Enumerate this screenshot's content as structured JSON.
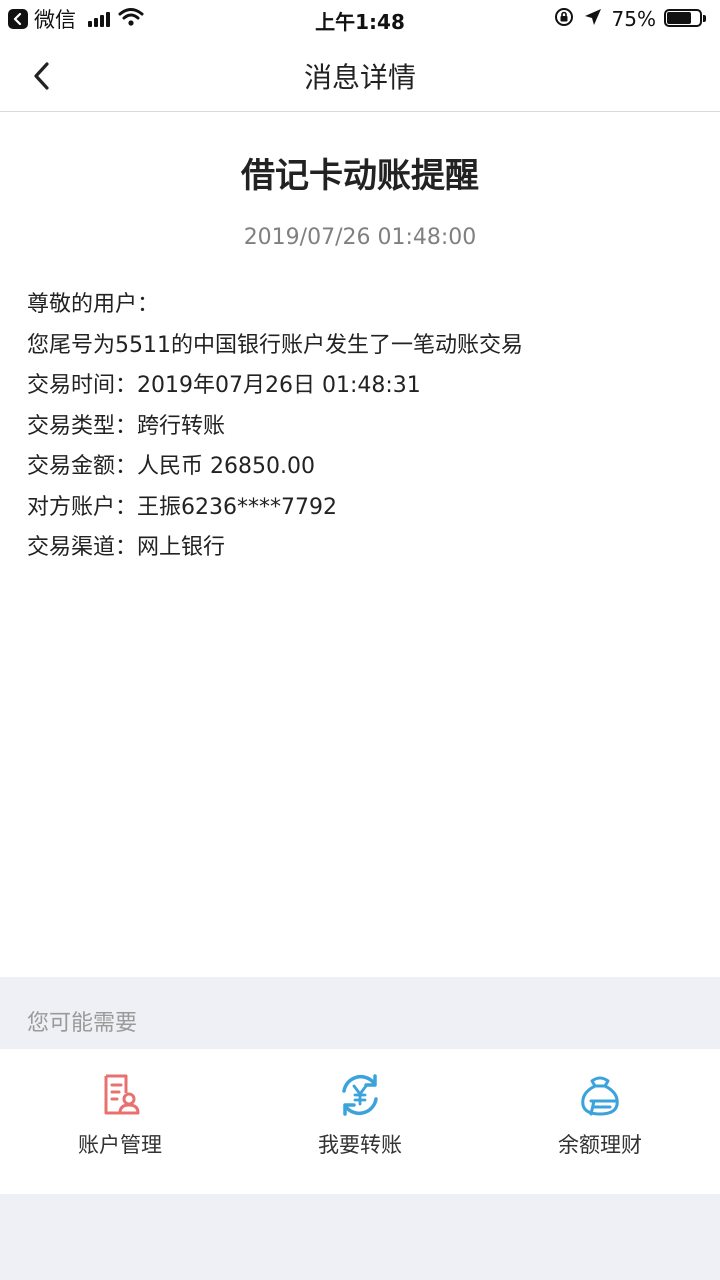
{
  "status_bar": {
    "app_name": "微信",
    "time": "上午1:48",
    "battery_percent": "75%",
    "battery_level": 0.75
  },
  "nav": {
    "title": "消息详情"
  },
  "message": {
    "title": "借记卡动账提醒",
    "date": "2019/07/26 01:48:00",
    "lines": [
      "尊敬的用户：",
      "您尾号为5511的中国银行账户发生了一笔动账交易",
      "交易时间：2019年07月26日 01:48:31",
      "交易类型：跨行转账",
      "交易金额：人民币 26850.00",
      "对方账户：王振6236****7792",
      "交易渠道：网上银行"
    ]
  },
  "suggestions": {
    "title": "您可能需要",
    "items": [
      {
        "label": "账户管理",
        "icon": "account-management-icon",
        "color": "#e8716f"
      },
      {
        "label": "我要转账",
        "icon": "transfer-icon",
        "color": "#3aa3dc"
      },
      {
        "label": "余额理财",
        "icon": "wealth-management-icon",
        "color": "#3aa3dc"
      }
    ]
  }
}
